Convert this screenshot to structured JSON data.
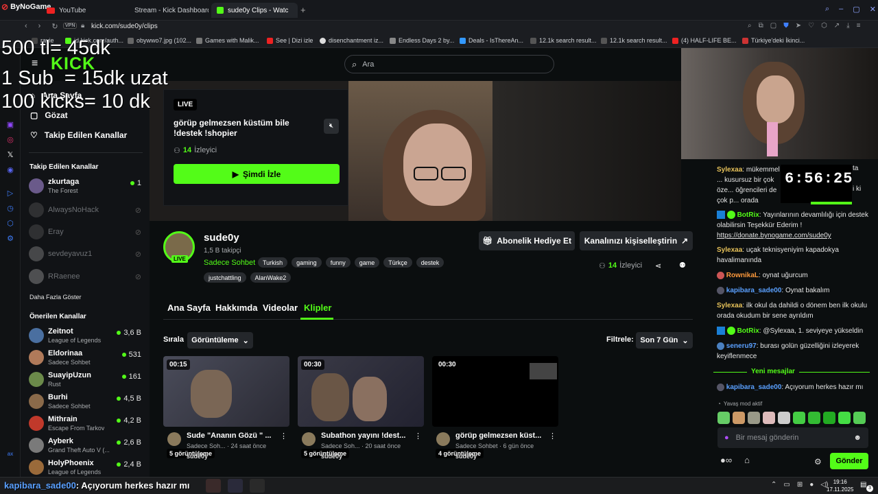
{
  "browser": {
    "logo": "ByNoGame",
    "tabs": [
      {
        "label": "YouTube",
        "active": false
      },
      {
        "label": "Stream - Kick Dashboard",
        "active": false
      },
      {
        "label": "sude0y Clips - Watch Live",
        "active": true
      }
    ],
    "vpn_label": "VPN",
    "url": "kick.com/sude0y/clips",
    "bookmarks": [
      "ravie",
      "id.kick.com/auth...",
      "obywwo7.jpg (102...",
      "Games with Malik...",
      "See | Dizi izle",
      "disenchantment iz...",
      "Endless Days 2 by...",
      "Deals - IsThereAn...",
      "12.1k search result...",
      "12.1k search result...",
      "(4) HALF-LIFE BE...",
      "Türkiye'deki İkinci..."
    ],
    "accent_color": "#3f7fff"
  },
  "overlay": {
    "lines": [
      "500 tl= 45dk",
      "1 Sub  = 15dk uzat",
      "100 kicks= 10 dk"
    ]
  },
  "kick": {
    "brand_color": "#53fc18",
    "logo": "KICK",
    "search_placeholder": "Ara",
    "nav": [
      "Ana Sayfa",
      "Gözat",
      "Takip Edilen Kanallar"
    ],
    "followed_title": "Takip Edilen Kanallar",
    "followed": [
      {
        "name": "zkurtaga",
        "game": "The Forest",
        "viewers": "1",
        "live": true
      },
      {
        "name": "AlwaysNoHack",
        "live": false
      },
      {
        "name": "Eray",
        "live": false
      },
      {
        "name": "sevdeyavuz1",
        "live": false
      },
      {
        "name": "RRaenee",
        "live": false
      }
    ],
    "show_more": "Daha Fazla Göster",
    "recommended_title": "Önerilen Kanallar",
    "recommended": [
      {
        "name": "Zeitnot",
        "game": "League of Legends",
        "viewers": "3,6 B"
      },
      {
        "name": "Eldorinaa",
        "game": "Sadece Sohbet",
        "viewers": "531"
      },
      {
        "name": "SuayipUzun",
        "game": "Rust",
        "viewers": "161"
      },
      {
        "name": "Burhi",
        "game": "Sadece Sohbet",
        "viewers": "4,5 B"
      },
      {
        "name": "Mithrain",
        "game": "Escape From Tarkov",
        "viewers": "4,2 B"
      },
      {
        "name": "Ayberk",
        "game": "Grand Theft Auto V (...",
        "viewers": "2,6 B"
      },
      {
        "name": "HolyPhoenix",
        "game": "League of Legends",
        "viewers": "2,4 B"
      }
    ],
    "live_card": {
      "badge": "LIVE",
      "title": "görüp gelmezsen küstüm bile !destek !shopier",
      "viewers_count": "14",
      "viewers_label": "İzleyici",
      "watch_label": "Şimdi İzle"
    },
    "channel": {
      "name": "sude0y",
      "followers": "1,5 B takipçi",
      "category": "Sadece Sohbet",
      "live_badge": "LIVE",
      "tags": [
        "Turkish",
        "gaming",
        "funny",
        "game",
        "Türkçe",
        "destek",
        "justchattling",
        "AlanWake2"
      ],
      "gift_sub_label": "Abonelik Hediye Et",
      "customize_label": "Kanalınızı kişiselleştirin",
      "viewers_count": "14",
      "viewers_label": "İzleyici"
    },
    "tabs": [
      "Ana Sayfa",
      "Hakkımda",
      "Videolar",
      "Klipler"
    ],
    "active_tab": "Klipler",
    "sort_label": "Sırala",
    "sort_value": "Görüntüleme",
    "filter_label": "Filtrele:",
    "filter_value": "Son 7 Gün",
    "clips": [
      {
        "duration": "00:15",
        "views": "5 görüntüleme",
        "title": "Sude \"Ananın Gözü \" ...",
        "meta": "Sadece Soh... · 24 saat önce",
        "user": "sude0y"
      },
      {
        "duration": "00:30",
        "views": "5 görüntüleme",
        "title": "Subathon yayını !dest...",
        "meta": "Sadece Soh... · 20 saat önce",
        "user": "sude0y"
      },
      {
        "duration": "00:30",
        "views": "4 görüntüleme",
        "title": "görüp gelmezsen küst...",
        "meta": "Sadece Sohbet · 6 gün önce",
        "user": "sude0y"
      }
    ]
  },
  "stream_overlay": {
    "timer": "6:56:25"
  },
  "chat": {
    "messages": [
      {
        "user": "Sylexaa",
        "color": "#e8c35a",
        "text": "mükemmel ... kusursuz bir çok öze... öğrencileri de çok p... orada okudum 7 sen..."
      },
      {
        "user": "BotRix",
        "color": "#53fc18",
        "text": "Yayınlarının devamlılığı için destek olabilirsin Teşekkür Ederim !",
        "link": "https://donate.bynogame.com/sude0y"
      },
      {
        "user": "Sylexaa",
        "color": "#e8c35a",
        "text": "uçak teknisyeniyim kapadokya havalimanında"
      },
      {
        "user": "RownikaL",
        "color": "#ff9a3c",
        "text": "oynat uğurcum"
      },
      {
        "user": "kapibara_sade00",
        "color": "#5aa0ff",
        "text": "Oynat bakalım"
      },
      {
        "user": "Sylexaa",
        "color": "#e8c35a",
        "text": "ilk okul da dahildi o dönem ben ilk okulu orada okudum bir sene ayrıldım"
      },
      {
        "user": "BotRix",
        "color": "#53fc18",
        "text": "@Sylexaa, 1. seviyeye yükseldin"
      },
      {
        "user": "seneru97",
        "color": "#5aa0ff",
        "text": "burası golün güzelliğini izleyerek keyiflenmece"
      }
    ],
    "new_messages": "Yeni mesajlar",
    "latest": {
      "user": "kapibara_sade00",
      "color": "#5aa0ff",
      "text": "Açıyorum herkes hazır mı"
    },
    "slow_mode": "Yavaş mod aktif",
    "input_placeholder": "Bir mesaj gönderin",
    "send_label": "Gönder"
  },
  "taskbar": {
    "ticker_user": "kapibara_sade00",
    "ticker_text": ": Açıyorum herkes hazır mı",
    "time": "19:16",
    "date": "17.11.2025",
    "notif_count": "3"
  }
}
